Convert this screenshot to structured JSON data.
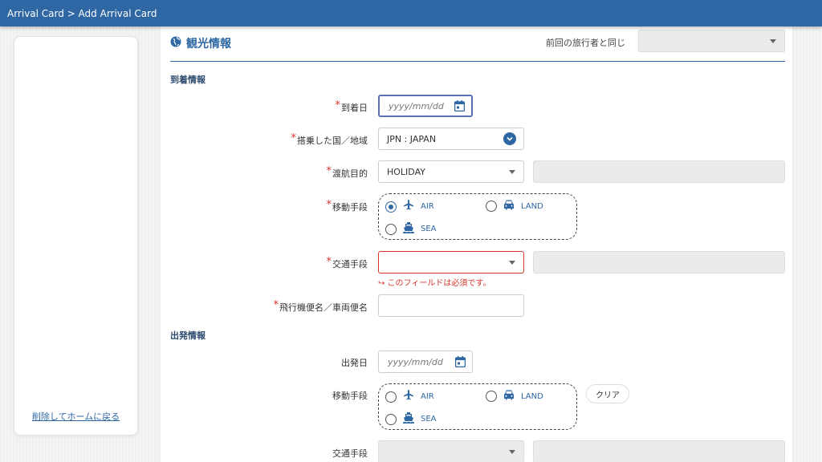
{
  "topbar": {
    "breadcrumb": "Arrival Card > Add Arrival Card"
  },
  "sidebar": {
    "delete_home_link": "削除してホームに戻る"
  },
  "section": {
    "title": "観光情報",
    "same_as_prev_label": "前回の旅行者と同じ",
    "same_as_prev_value": ""
  },
  "arrival": {
    "heading": "到着情報",
    "date_label": "到着日",
    "date_placeholder": "yyyy/mm/dd",
    "country_label": "搭乗した国／地域",
    "country_value": "JPN : JAPAN",
    "purpose_label": "渡航目的",
    "purpose_value": "HOLIDAY",
    "mode_label": "移動手段",
    "modes": [
      {
        "label": "AIR",
        "checked": true,
        "icon": "airplane-icon"
      },
      {
        "label": "LAND",
        "checked": false,
        "icon": "car-icon"
      },
      {
        "label": "SEA",
        "checked": false,
        "icon": "ship-icon"
      }
    ],
    "transport_label": "交通手段",
    "transport_value": "",
    "transport_error": "↪ このフィールドは必須です。",
    "flight_label": "飛行機便名／車両便名",
    "flight_value": ""
  },
  "departure": {
    "heading": "出発情報",
    "date_label": "出発日",
    "date_placeholder": "yyyy/mm/dd",
    "mode_label": "移動手段",
    "modes": [
      {
        "label": "AIR",
        "checked": false,
        "icon": "airplane-icon"
      },
      {
        "label": "LAND",
        "checked": false,
        "icon": "car-icon"
      },
      {
        "label": "SEA",
        "checked": false,
        "icon": "ship-icon"
      }
    ],
    "clear_label": "クリア",
    "transport_label": "交通手段"
  },
  "colors": {
    "brand": "#2e67a3",
    "error": "#d9342b"
  }
}
